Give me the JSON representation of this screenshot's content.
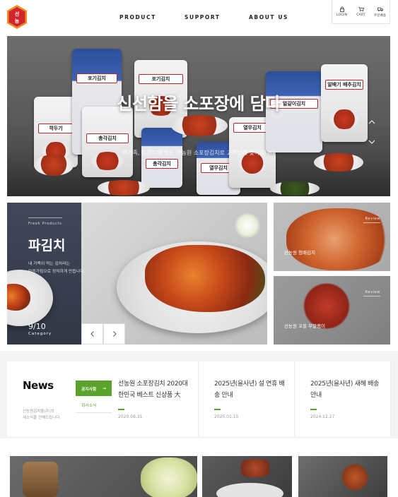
{
  "header": {
    "logo_text": "선농",
    "nav": [
      "PRODUCT",
      "SUPPORT",
      "ABOUT US"
    ],
    "utils": [
      {
        "label": "LOGIN",
        "icon": "lock-icon"
      },
      {
        "label": "CART",
        "icon": "cart-icon"
      },
      {
        "label": "주문배송",
        "icon": "truck-icon"
      }
    ]
  },
  "hero": {
    "title": "신선함을 소포장에 담다",
    "subtitle": "핵가족, 트렌드에 맞는 선농원 소포장김치로 고객님께 찾아갑니다",
    "packages": [
      "포기김치",
      "깍두기",
      "총각김치",
      "열무김치",
      "얼갈이김치",
      "열무김치",
      "알배기 배추김치",
      "총각김치"
    ]
  },
  "product": {
    "eyebrow": "Fresh Products",
    "title": "파김치",
    "desc_lines": [
      "내 가족이 먹는 김치라는",
      "마음가짐으로 정직하게 만듭니다."
    ],
    "counter": "9/10",
    "category": "Category",
    "side": [
      {
        "review": "Review",
        "name": "선농원 청배김치"
      },
      {
        "review": "Review",
        "name": "선농원 꼬들 무말랭이"
      }
    ]
  },
  "news": {
    "title": "News",
    "desc_lines": [
      "선농원김치몰(주)의",
      "새소식을 전해드립니다."
    ],
    "tabs": [
      "공지사항",
      "회사소식"
    ],
    "items": [
      {
        "title": "선농원 소포장김치 2020대한민국 베스트 신상품 大",
        "date": "2020.08.31"
      },
      {
        "title": "2025년(을사년) 설 연휴 배송 안내",
        "date": "2025.01.15"
      },
      {
        "title": "2025년(을사년) 새해 배송 안내",
        "date": "2024.12.27"
      }
    ]
  },
  "colors": {
    "accent_green": "#5aa32a",
    "logo_red": "#d3242b",
    "logo_orange": "#f08a24"
  }
}
